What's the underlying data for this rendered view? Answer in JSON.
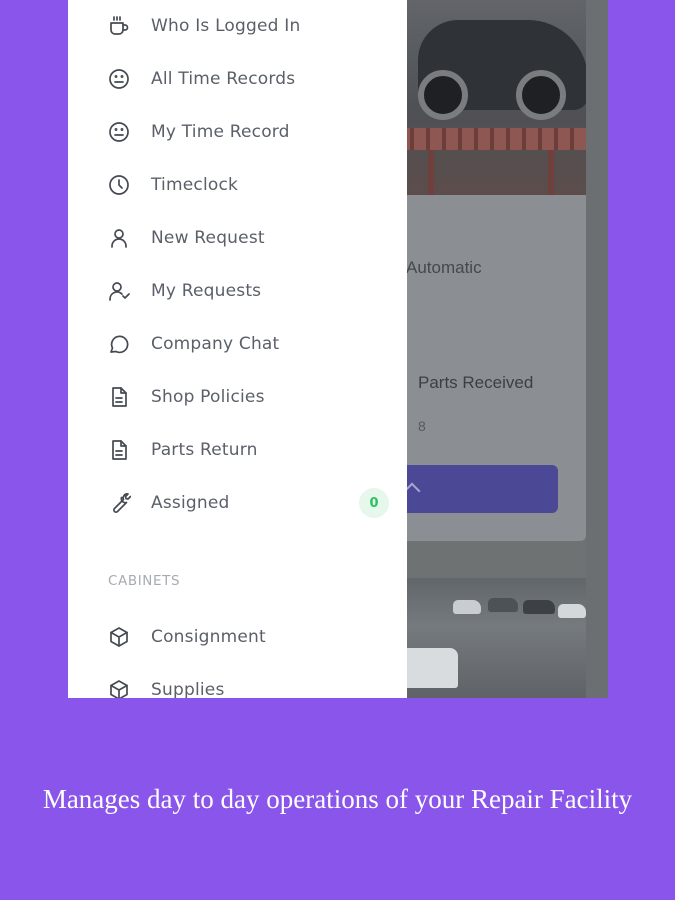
{
  "background_app": {
    "transmission_text": "Automatic",
    "parts_label": "Parts Received",
    "parts_value": "8"
  },
  "drawer": {
    "items": [
      {
        "label": "Who Is Logged In",
        "icon": "coffee-cup-icon"
      },
      {
        "label": "All Time Records",
        "icon": "face-neutral-icon"
      },
      {
        "label": "My Time Record",
        "icon": "face-neutral-icon"
      },
      {
        "label": "Timeclock",
        "icon": "clock-icon"
      },
      {
        "label": "New Request",
        "icon": "user-icon"
      },
      {
        "label": "My Requests",
        "icon": "user-check-icon"
      },
      {
        "label": "Company Chat",
        "icon": "chat-bubble-icon"
      },
      {
        "label": "Shop Policies",
        "icon": "document-icon"
      },
      {
        "label": "Parts Return",
        "icon": "document-icon"
      },
      {
        "label": "Assigned",
        "icon": "wrench-icon",
        "badge": "0"
      }
    ],
    "section_cabinets": "CABINETS",
    "cabinet_items": [
      {
        "label": "Consignment",
        "icon": "box-icon"
      },
      {
        "label": "Supplies",
        "icon": "box-icon"
      }
    ]
  },
  "caption": "Manages day to day operations of your Repair Facility",
  "colors": {
    "page_background": "#8a55ea",
    "badge_text": "#2fbf63",
    "badge_background": "#e6f7ec",
    "button_background": "#4b4896"
  }
}
